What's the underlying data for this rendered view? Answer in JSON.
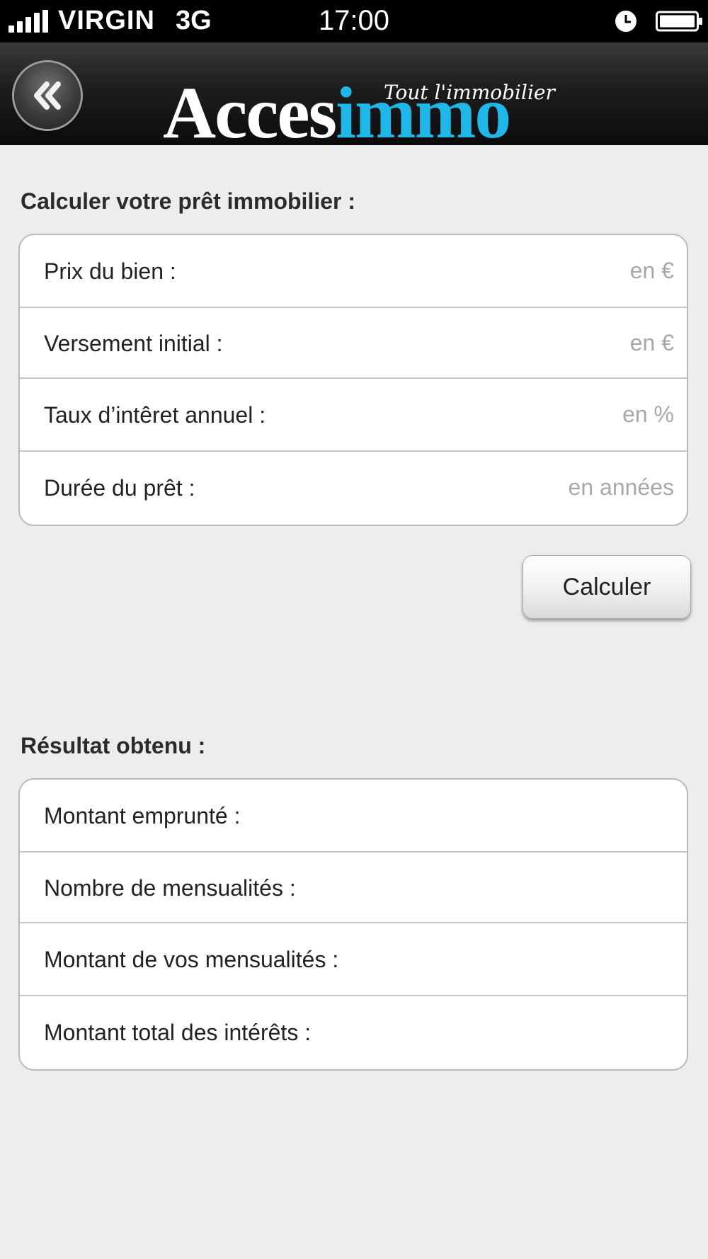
{
  "status_bar": {
    "carrier": "VIRGIN",
    "network": "3G",
    "time": "17:00",
    "icons": [
      "signal-icon",
      "alarm-icon",
      "battery-icon"
    ]
  },
  "header": {
    "back_icon": "double-chevron-left-icon",
    "logo": {
      "part1": "Acces",
      "part2": "immo",
      "tagline": "Tout l'immobilier"
    },
    "colors": {
      "logo_accent": "#1fb7e8",
      "header_bg": "#1a1a1a"
    }
  },
  "loan_form": {
    "title": "Calculer votre prêt immobilier :",
    "fields": [
      {
        "label": "Prix du bien :",
        "value": "",
        "placeholder": "en €"
      },
      {
        "label": "Versement initial :",
        "value": "",
        "placeholder": "en €"
      },
      {
        "label": "Taux d’intêret annuel :",
        "value": "",
        "placeholder": "en %"
      },
      {
        "label": "Durée du prêt :",
        "value": "",
        "placeholder": "en années"
      }
    ],
    "submit_label": "Calculer"
  },
  "results": {
    "title": "Résultat obtenu :",
    "rows": [
      {
        "label": "Montant emprunté :",
        "value": ""
      },
      {
        "label": "Nombre de mensualités :",
        "value": ""
      },
      {
        "label": "Montant de vos mensualités :",
        "value": ""
      },
      {
        "label": "Montant total des intérêts :",
        "value": ""
      }
    ]
  }
}
